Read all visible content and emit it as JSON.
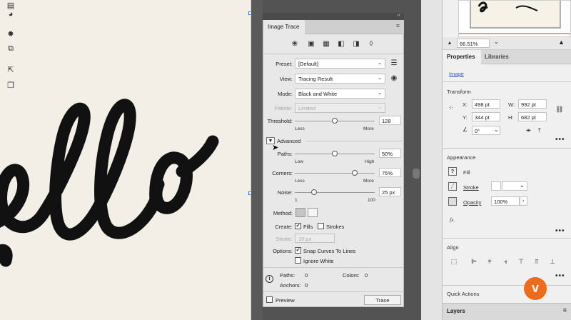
{
  "image_trace": {
    "title": "Image Trace",
    "collapse_glyph": "‹‹",
    "menu_glyph": "≡",
    "preset": {
      "label": "Preset:",
      "value": "[Default]"
    },
    "view": {
      "label": "View:",
      "value": "Tracing Result"
    },
    "mode": {
      "label": "Mode:",
      "value": "Black and White"
    },
    "palette": {
      "label": "Palette:",
      "value": "Limited"
    },
    "threshold": {
      "label": "Threshold:",
      "value": "128",
      "min_label": "Less",
      "max_label": "More",
      "level": 0.5
    },
    "advanced_label": "Advanced",
    "paths": {
      "label": "Paths:",
      "value": "50%",
      "min_label": "Low",
      "max_label": "High",
      "level": 0.5
    },
    "corners": {
      "label": "Corners:",
      "value": "75%",
      "min_label": "Less",
      "max_label": "More",
      "level": 0.75
    },
    "noise": {
      "label": "Noise:",
      "value": "25 px",
      "min_label": "1",
      "max_label": "100",
      "level": 0.24
    },
    "method_label": "Method:",
    "create_label": "Create:",
    "fills_label": "Fills",
    "strokes_label": "Strokes",
    "stroke": {
      "label": "Stroke:",
      "value": "10 px"
    },
    "options_label": "Options:",
    "snap_label": "Snap Curves To Lines",
    "ignore_white_label": "Ignore White",
    "stats": {
      "paths_label": "Paths:",
      "paths_value": "0",
      "colors_label": "Colors:",
      "colors_value": "0",
      "anchors_label": "Anchors:",
      "anchors_value": "0"
    },
    "preview_label": "Preview",
    "trace_label": "Trace"
  },
  "properties": {
    "zoom": "66.51%",
    "tabs": {
      "properties": "Properties",
      "libraries": "Libraries"
    },
    "object_type": "Image",
    "transform": {
      "title": "Transform",
      "x_label": "X:",
      "x": "498 pt",
      "y_label": "Y:",
      "y": "344 pt",
      "w_label": "W:",
      "w": "992 pt",
      "h_label": "H:",
      "h": "682 pt",
      "angle": "0°"
    },
    "appearance": {
      "title": "Appearance",
      "fill": "Fill",
      "stroke": "Stroke",
      "opacity": "Opacity",
      "opacity_value": "100%",
      "fx": "fx."
    },
    "align": {
      "title": "Align"
    },
    "quick_actions": "Quick Actions",
    "layers": "Layers"
  },
  "colors": {
    "accent_orange": "#ee6a1c",
    "selection_blue": "#3b6fd6"
  }
}
